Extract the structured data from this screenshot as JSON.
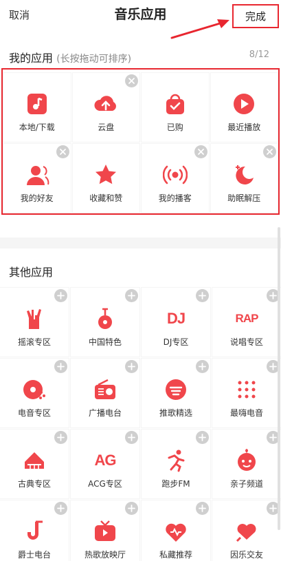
{
  "header": {
    "cancel": "取消",
    "title": "音乐应用",
    "done": "完成"
  },
  "my_apps": {
    "title": "我的应用",
    "hint": "(长按拖动可排序)",
    "count": "8/12",
    "items": [
      {
        "label": "本地/下载",
        "icon": "local-download-icon",
        "removable": false
      },
      {
        "label": "云盘",
        "icon": "cloud-disk-icon",
        "removable": true
      },
      {
        "label": "已购",
        "icon": "purchased-bag-icon",
        "removable": false
      },
      {
        "label": "最近播放",
        "icon": "recent-play-icon",
        "removable": false
      },
      {
        "label": "我的好友",
        "icon": "friends-icon",
        "removable": true
      },
      {
        "label": "收藏和赞",
        "icon": "star-icon",
        "removable": false
      },
      {
        "label": "我的播客",
        "icon": "podcast-icon",
        "removable": true
      },
      {
        "label": "助眠解压",
        "icon": "sleep-moon-icon",
        "removable": true
      }
    ]
  },
  "other_apps": {
    "title": "其他应用",
    "items": [
      {
        "label": "摇滚专区",
        "icon": "rock-hand-icon"
      },
      {
        "label": "中国特色",
        "icon": "chinese-instrument-icon"
      },
      {
        "label": "DJ专区",
        "icon": "dj-icon",
        "icon_text": "DJ"
      },
      {
        "label": "说唱专区",
        "icon": "rap-icon",
        "icon_text": "RAP"
      },
      {
        "label": "电音专区",
        "icon": "electronic-disc-icon"
      },
      {
        "label": "广播电台",
        "icon": "radio-icon"
      },
      {
        "label": "推歌精选",
        "icon": "recommend-icon"
      },
      {
        "label": "最嗨电音",
        "icon": "dots-icon"
      },
      {
        "label": "古典专区",
        "icon": "piano-icon"
      },
      {
        "label": "ACG专区",
        "icon": "acg-icon",
        "icon_text": "AG"
      },
      {
        "label": "跑步FM",
        "icon": "running-icon"
      },
      {
        "label": "亲子频道",
        "icon": "kid-face-icon"
      },
      {
        "label": "爵士电台",
        "icon": "saxophone-icon"
      },
      {
        "label": "热歌放映厅",
        "icon": "tv-icon"
      },
      {
        "label": "私藏推荐",
        "icon": "heart-wave-icon"
      },
      {
        "label": "因乐交友",
        "icon": "heart-chat-icon"
      }
    ]
  },
  "colors": {
    "accent": "#e8262f",
    "icon_red": "#f0464b",
    "badge": "#cfcfcf"
  }
}
